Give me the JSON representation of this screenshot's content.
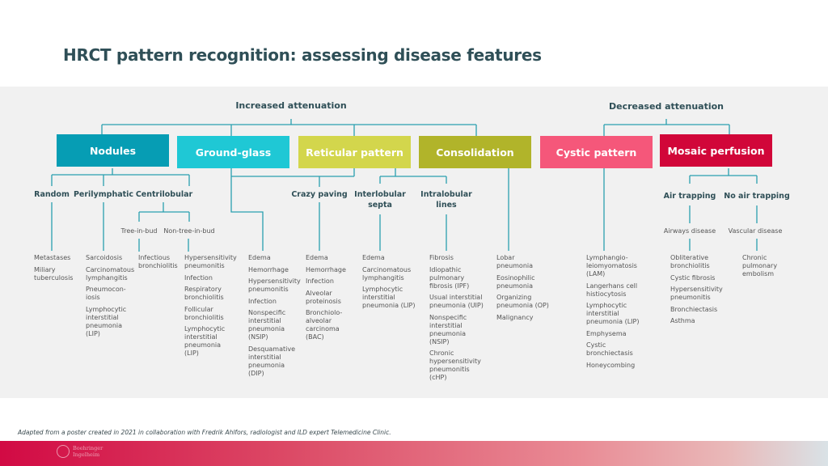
{
  "title": "HRCT pattern recognition: assessing disease features",
  "groups": {
    "increased": "Increased attenuation",
    "decreased": "Decreased attenuation"
  },
  "patterns": [
    {
      "label": "Nodules",
      "color": "#069db4"
    },
    {
      "label": "Ground-glass",
      "color": "#1fc8d5"
    },
    {
      "label": "Reticular pattern",
      "color": "#d3d64c"
    },
    {
      "label": "Consolidation",
      "color": "#b1b42a"
    },
    {
      "label": "Cystic pattern",
      "color": "#f5577a"
    },
    {
      "label": "Mosaic perfusion",
      "color": "#d10639"
    }
  ],
  "subcategories": {
    "random": "Random",
    "perilymphatic": "Perilymphatic",
    "centrilobular": "Centrilobular",
    "crazy_paving": "Crazy paving",
    "interlobular": "Interlobular\nsepta",
    "intralobular": "Intralobular\nlines",
    "air_trapping": "Air trapping",
    "no_air_trapping": "No air trapping"
  },
  "minor": {
    "tree_in_bud": "Tree-in-bud",
    "non_tree_in_bud": "Non-tree-in-bud",
    "airways": "Airways disease",
    "vascular": "Vascular disease"
  },
  "columns": [
    [
      "Metastases",
      "Miliary\ntuberculosis"
    ],
    [
      "Sarcoidosis",
      "Carcinomatous\nlymphangitis",
      "Pneumocon-\niosis",
      "Lymphocytic\ninterstitial\npneumonia\n(LIP)"
    ],
    [
      "Infectious\nbronchiolitis"
    ],
    [
      "Hypersensitivity\npneumonitis",
      "Infection",
      "Respiratory\nbronchiolitis",
      "Follicular\nbronchiolitis",
      "Lymphocytic\ninterstitial\npneumonia\n(LIP)"
    ],
    [
      "Edema",
      "Hemorrhage",
      "Hypersensitivity\npneumonitis",
      "Infection",
      "Nonspecific\ninterstitial\npneumonia\n(NSIP)",
      "Desquamative\ninterstitial\npneumonia\n(DIP)"
    ],
    [
      "Edema",
      "Hemorrhage",
      "Infection",
      "Alveolar\nproteinosis",
      "Bronchiolo-\nalveolar\ncarcinoma\n(BAC)"
    ],
    [
      "Edema",
      "Carcinomatous\nlymphangitis",
      "Lymphocytic\ninterstitial\npneumonia (LIP)"
    ],
    [
      "Fibrosis",
      "Idiopathic\npulmonary\nfibrosis (IPF)",
      "Usual interstitial\npneumonia (UIP)",
      "Nonspecific\ninterstitial\npneumonia\n(NSIP)",
      "Chronic\nhypersensitivity\npneumonitis\n(cHP)"
    ],
    [
      "Lobar\npneumonia",
      "Eosinophilic\npneumonia",
      "Organizing\npneumonia (OP)",
      "Malignancy"
    ],
    [
      "Lymphangio-\nleiomyomatosis\n(LAM)",
      "Langerhans cell\nhistiocytosis",
      "Lymphocytic\ninterstitial\npneumonia (LIP)",
      "Emphysema",
      "Cystic\nbronchiectasis",
      "Honeycombing"
    ],
    [
      "Obliterative\nbronchiolitis",
      "Cystic fibrosis",
      "Hypersensitivity\npneumonitis",
      "Bronchiectasis",
      "Asthma"
    ],
    [
      "Chronic\npulmonary\nembolism"
    ]
  ],
  "footnote": "Adapted from a poster created in 2021 in collaboration with Fredrik Ahlfors, radiologist and ILD expert Telemedicine Clinic.",
  "logo_text": "Boehringer Ingelheim",
  "line_color": "#2a9fb0"
}
